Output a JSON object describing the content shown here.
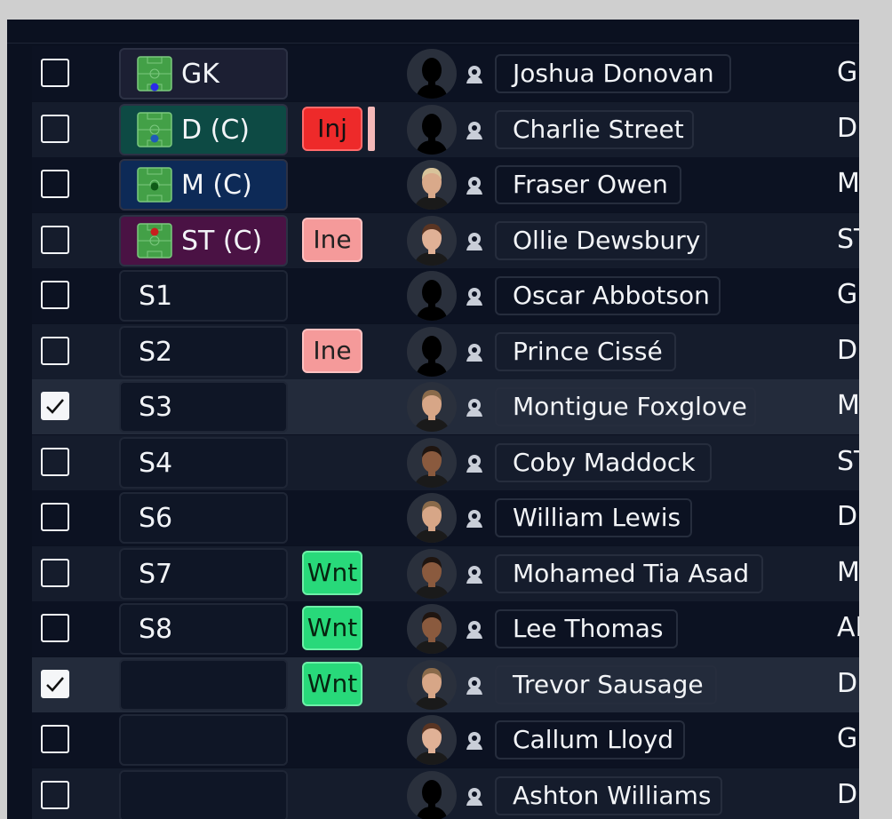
{
  "rows": [
    {
      "pos": "GK",
      "pitch": true,
      "pitch_bg": "#1c1f33",
      "dot": "#2a2ae8",
      "dot_pos": "bottom",
      "status": "",
      "status_type": "",
      "extra": false,
      "name": "Joshua Donovan",
      "col": "G",
      "checked": false,
      "face": "silhouette"
    },
    {
      "pos": "D (C)",
      "pitch": true,
      "pitch_bg": "#0d4a44",
      "dot": "#1f5bb8",
      "dot_pos": "lower",
      "status": "Inj",
      "status_type": "inj",
      "extra": true,
      "name": "Charlie Street",
      "col": "D",
      "checked": false,
      "face": "silhouette"
    },
    {
      "pos": "M (C)",
      "pitch": true,
      "pitch_bg": "#0d2a57",
      "dot": "#0f5a17",
      "dot_pos": "middle",
      "status": "",
      "status_type": "",
      "extra": false,
      "name": "Fraser Owen",
      "col": "M",
      "checked": false,
      "face": "blond"
    },
    {
      "pos": "ST (C)",
      "pitch": true,
      "pitch_bg": "#4a1244",
      "dot": "#c81e1e",
      "dot_pos": "top",
      "status": "Ine",
      "status_type": "ine",
      "extra": false,
      "name": "Ollie Dewsbury",
      "col": "ST",
      "checked": false,
      "face": "brown"
    },
    {
      "pos": "S1",
      "pitch": false,
      "status": "",
      "status_type": "",
      "extra": false,
      "name": "Oscar Abbotson",
      "col": "G",
      "checked": false,
      "face": "silhouette"
    },
    {
      "pos": "S2",
      "pitch": false,
      "status": "Ine",
      "status_type": "ine",
      "extra": false,
      "name": "Prince Cissé",
      "col": "D",
      "checked": false,
      "face": "silhouette"
    },
    {
      "pos": "S3",
      "pitch": false,
      "status": "",
      "status_type": "",
      "extra": false,
      "name": "Montigue Foxglove",
      "col": "M",
      "checked": true,
      "face": "light"
    },
    {
      "pos": "S4",
      "pitch": false,
      "status": "",
      "status_type": "",
      "extra": false,
      "name": "Coby Maddock",
      "col": "ST",
      "checked": false,
      "face": "dark"
    },
    {
      "pos": "S6",
      "pitch": false,
      "status": "",
      "status_type": "",
      "extra": false,
      "name": "William Lewis",
      "col": "D",
      "checked": false,
      "face": "light"
    },
    {
      "pos": "S7",
      "pitch": false,
      "status": "Wnt",
      "status_type": "wnt",
      "extra": false,
      "name": "Mohamed Tia Asad",
      "col": "M",
      "checked": false,
      "face": "dark"
    },
    {
      "pos": "S8",
      "pitch": false,
      "status": "Wnt",
      "status_type": "wnt",
      "extra": false,
      "name": "Lee Thomas",
      "col": "AI",
      "checked": false,
      "face": "dark"
    },
    {
      "pos": "",
      "pitch": false,
      "status": "Wnt",
      "status_type": "wnt",
      "extra": false,
      "name": "Trevor Sausage",
      "col": "D",
      "checked": true,
      "face": "light"
    },
    {
      "pos": "",
      "pitch": false,
      "status": "",
      "status_type": "",
      "extra": false,
      "name": "Callum Lloyd",
      "col": "G",
      "checked": false,
      "face": "brown"
    },
    {
      "pos": "",
      "pitch": false,
      "status": "",
      "status_type": "",
      "extra": false,
      "name": "Ashton Williams",
      "col": "D",
      "checked": false,
      "face": "silhouette"
    }
  ],
  "colors": {
    "inj": "#ee2a2a",
    "ine": "#f59a9a",
    "wnt": "#28d97a",
    "pitch_green": "#43a047"
  }
}
